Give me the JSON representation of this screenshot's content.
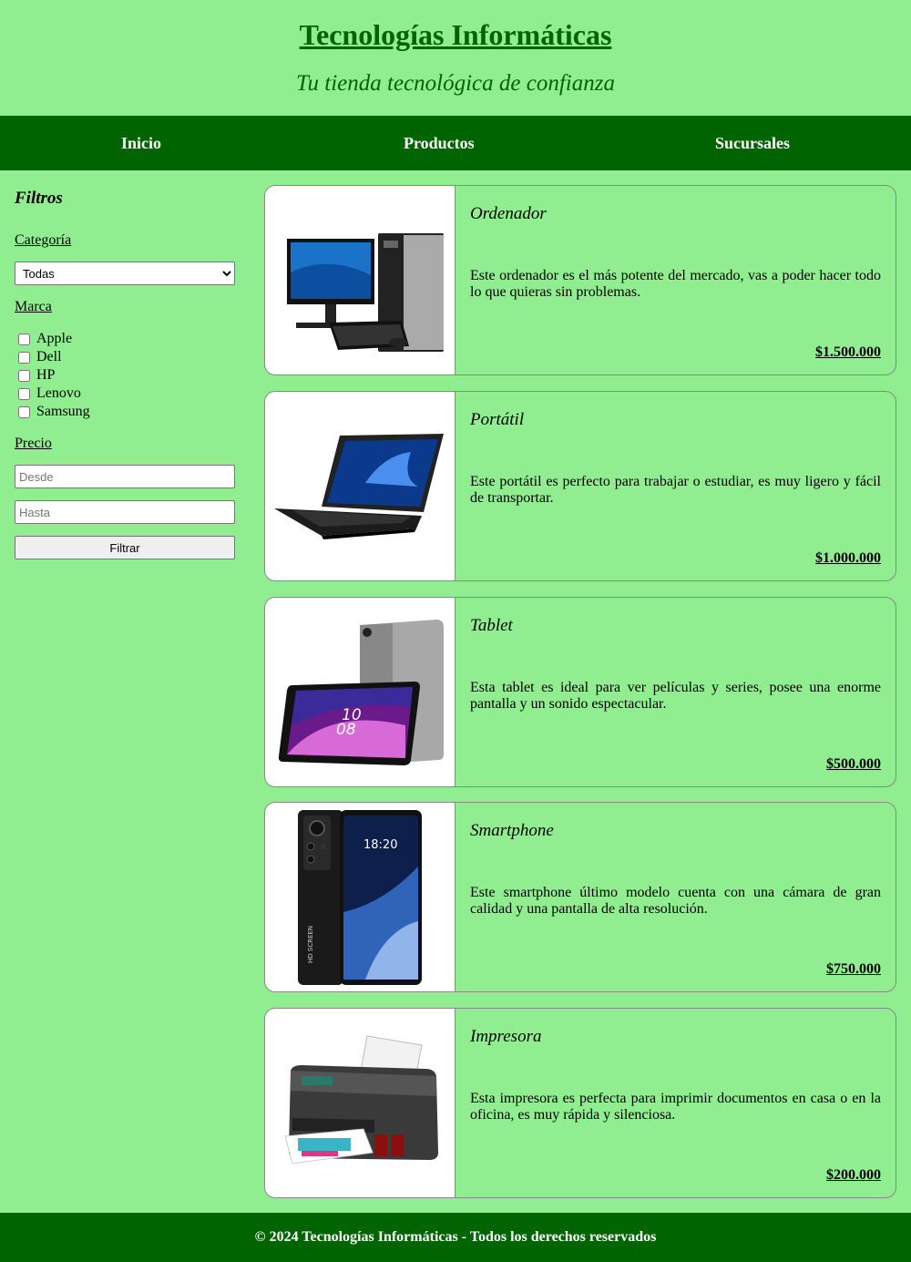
{
  "header": {
    "title": "Tecnologías Informáticas",
    "tagline": "Tu tienda tecnológica de confianza"
  },
  "nav": {
    "items": [
      "Inicio",
      "Productos",
      "Sucursales"
    ]
  },
  "filters": {
    "title": "Filtros",
    "category_label": "Categoría",
    "category_selected": "Todas",
    "brand_label": "Marca",
    "brands": [
      "Apple",
      "Dell",
      "HP",
      "Lenovo",
      "Samsung"
    ],
    "price_label": "Precio",
    "from_placeholder": "Desde",
    "to_placeholder": "Hasta",
    "button_label": "Filtrar"
  },
  "products": [
    {
      "name": "Ordenador",
      "icon": "desktop-computer-image",
      "description": "Este ordenador es el más potente del mercado, vas a poder hacer todo lo que quieras sin problemas.",
      "price": "$1.500.000"
    },
    {
      "name": "Portátil",
      "icon": "laptop-image",
      "description": "Este portátil es perfecto para trabajar o estudiar, es muy ligero y fácil de transportar.",
      "price": "$1.000.000"
    },
    {
      "name": "Tablet",
      "icon": "tablet-image",
      "description": "Esta tablet es ideal para ver películas y series, posee una enorme pantalla y un sonido espectacular.",
      "price": "$500.000",
      "screen_time": "10",
      "screen_min": "08"
    },
    {
      "name": "Smartphone",
      "icon": "smartphone-image",
      "description": "Este smartphone último modelo cuenta con una cámara de gran calidad y una pantalla de alta resolución.",
      "price": "$750.000",
      "screen_time": "18:20",
      "side_text": "HD SCREEN"
    },
    {
      "name": "Impresora",
      "icon": "printer-image",
      "description": "Esta impresora es perfecta para imprimir documentos en casa o en la oficina, es muy rápida y silenciosa.",
      "price": "$200.000"
    }
  ],
  "footer": {
    "text": "© 2024 Tecnologías Informáticas - Todos los derechos reservados"
  },
  "colors": {
    "background": "#90ee90",
    "dark_green": "#006400"
  }
}
